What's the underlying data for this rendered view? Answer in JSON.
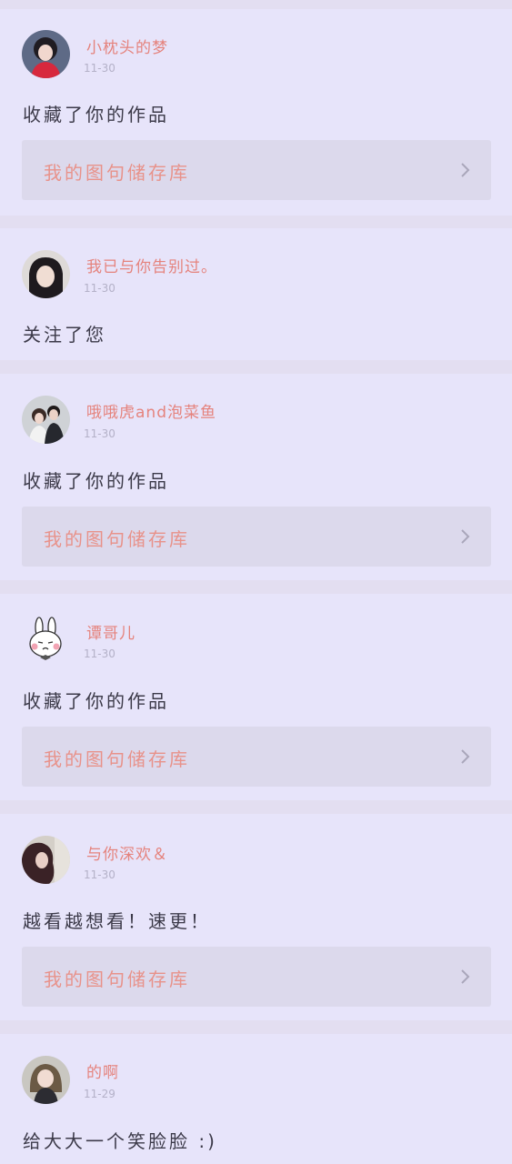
{
  "notifications": [
    {
      "username": "小枕头的梦",
      "date": "11-30",
      "message": "收藏了你的作品",
      "link_label": "我的图句储存库",
      "avatar": "girl-red-scarf-avatar"
    },
    {
      "username": "我已与你告别过。",
      "date": "11-30",
      "message": "关注了您",
      "link_label": null,
      "avatar": "girl-portrait-avatar"
    },
    {
      "username": "哦哦虎and泡菜鱼",
      "date": "11-30",
      "message": "收藏了你的作品",
      "link_label": "我的图句储存库",
      "avatar": "couple-photo-avatar"
    },
    {
      "username": "谭哥儿",
      "date": "11-30",
      "message": "收藏了你的作品",
      "link_label": "我的图句储存库",
      "avatar": "bunny-cartoon-avatar"
    },
    {
      "username": "与你深欢＆",
      "date": "11-30",
      "message": "越看越想看！速更！",
      "link_label": "我的图句储存库",
      "avatar": "long-hair-girl-avatar"
    },
    {
      "username": "的啊",
      "date": "11-29",
      "message": "给大大一个笑脸脸 :)",
      "link_label": null,
      "avatar": "anime-girl-avatar"
    }
  ],
  "colors": {
    "background": "#e3def1",
    "card": "#e7e4fa",
    "username": "#e5837d",
    "link_text": "#e8928a",
    "link_box": "#dcd9ec",
    "date": "#b4b1c8",
    "message": "#3c3a49",
    "chevron": "#a9a6ba"
  },
  "icons": {
    "link_arrow": "chevron-right-icon"
  }
}
